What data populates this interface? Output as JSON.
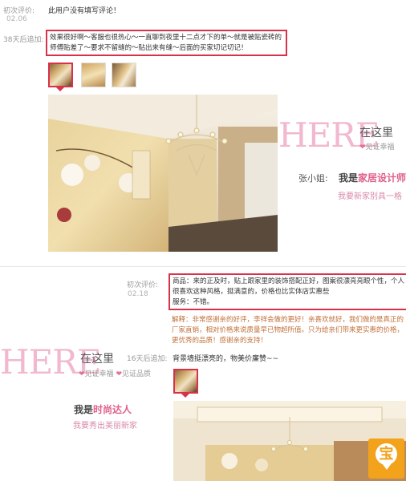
{
  "review1": {
    "initial_label": "初次评价:",
    "initial_text": "此用户没有填写评论！",
    "initial_date": "02.06",
    "append_label": "38天后追加:",
    "append_line1": "效果很好啊～客服也很热心～一直聊到夜里十二点才下的单～就是被贴瓷砖的",
    "append_line2": "师傅贴差了～要求不留缝的～贴出来有缝～后面的买家切记切记！"
  },
  "ad1": {
    "here": "HERE",
    "zaizheli": "在这里",
    "witness": "见证幸福",
    "name": "张小姐:",
    "title_pre": "我是",
    "title_hl": "家居设计师",
    "slogan": "我要新家别具一格"
  },
  "review2": {
    "initial_label": "初次评价:",
    "date": "02.18",
    "line1": "商品：来的正及时，贴上跟家里的装饰搭配正好，图案很漂亮亮眼个性，个人",
    "line2": "很喜欢这种风格，挺满意的，价格也比实体店实惠些",
    "line3": "服务：不错。",
    "explain1": "解释：非常感谢亲的好评，李祥会做的更好！亲喜欢就好，我们做的是真正的",
    "explain2": "厂家直销，相对价格来说质量早已物超所值。只为给亲们带来更实惠的价格，",
    "explain3": "更优秀的品质！感谢亲的支持！",
    "append_label": "16天后追加:",
    "append_text": "背景墙挺漂亮的，物美价廉赞~~"
  },
  "ad2": {
    "here": "HERE",
    "zaizheli": "在这里",
    "witness1": "见证幸福",
    "witness2": "见证品质",
    "title_pre": "我是",
    "title_hl": "时尚达人",
    "slogan": "我要秀出美丽新家"
  },
  "badge": {
    "char": "宝",
    "color": "#f2a21b"
  },
  "icons": [
    "heart-icon",
    "treasure-badge-icon",
    "chandelier-icon"
  ]
}
